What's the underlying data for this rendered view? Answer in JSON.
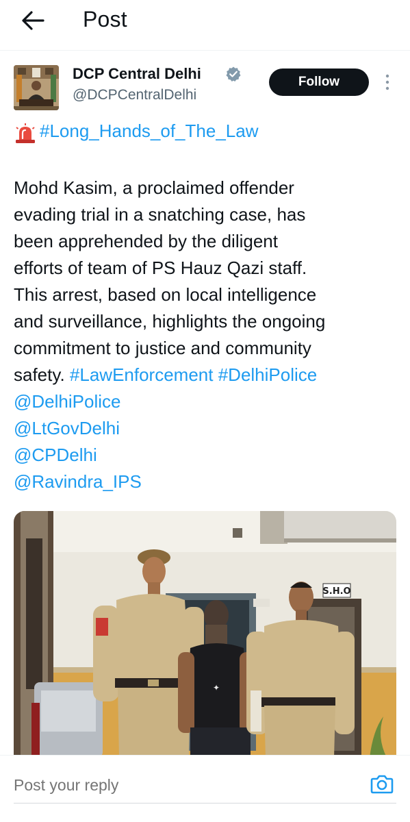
{
  "header": {
    "title": "Post",
    "back_icon": "arrow-left-icon"
  },
  "author": {
    "name": "DCP Central Delhi",
    "handle": "@DCPCentralDelhi",
    "verified_icon": "verified-badge-icon",
    "follow_label": "Follow",
    "more_icon": "more-vertical-icon"
  },
  "post": {
    "emoji_icon": "police-siren-icon",
    "headline_hashtag": "#Long_Hands_of_The_Law",
    "lines": [
      "Mohd Kasim, a proclaimed offender",
      "evading trial in a snatching case, has",
      "been apprehended by the diligent",
      "efforts of team of PS Hauz Qazi staff.",
      "This arrest, based on local intelligence",
      "and surveillance, highlights the ongoing",
      "commitment to justice and community"
    ],
    "last_line_text": "safety.",
    "hashtags": [
      "#LawEnforcement",
      "#DelhiPolice"
    ],
    "mentions": [
      "@DelhiPolice",
      "@LtGovDelhi",
      "@CPDelhi",
      "@Ravindra_IPS"
    ]
  },
  "media": {
    "kind": "photo",
    "sign_text": "S.H.O"
  },
  "reply": {
    "placeholder": "Post your reply",
    "camera_icon": "camera-icon"
  },
  "colors": {
    "link": "#1d9bf0",
    "text": "#0f1419",
    "secondary": "#536471",
    "follow_bg": "#0f1419"
  }
}
